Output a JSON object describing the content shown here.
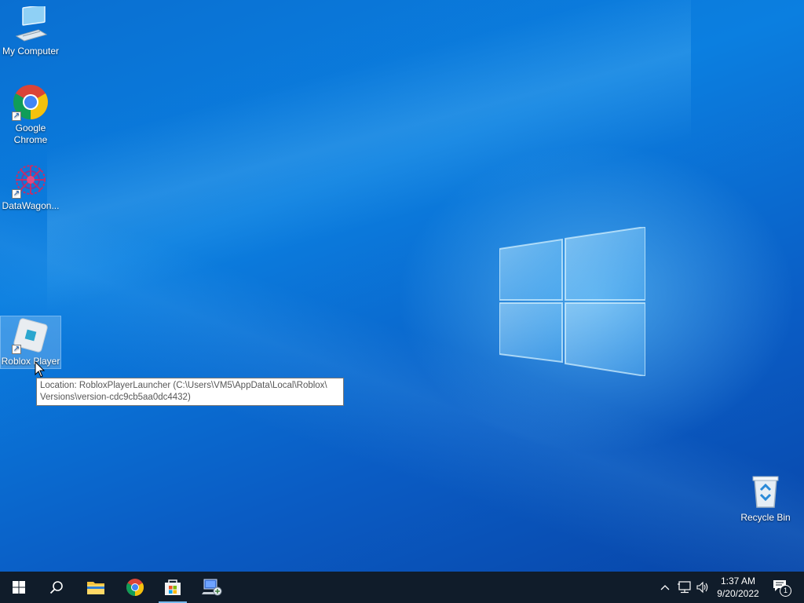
{
  "desktop": {
    "icons": [
      {
        "label": "My Computer",
        "icon": "computer-icon",
        "shortcut": false
      },
      {
        "label": "Google Chrome",
        "icon": "chrome-icon",
        "shortcut": true
      },
      {
        "label": "DataWagon...",
        "icon": "datawagon-icon",
        "shortcut": true
      },
      {
        "label": "Roblox Player",
        "icon": "roblox-icon",
        "shortcut": true,
        "selected": true
      },
      {
        "label": "Recycle Bin",
        "icon": "recycle-bin-icon",
        "shortcut": false
      }
    ],
    "tooltip": {
      "line1": "Location: RobloxPlayerLauncher (C:\\Users\\VM5\\AppData\\Local\\Roblox\\",
      "line2": "Versions\\version-cdc9cb5aa0dc4432)"
    }
  },
  "taskbar": {
    "items": [
      {
        "name": "start-button",
        "icon": "windows-icon"
      },
      {
        "name": "search-button",
        "icon": "search-icon"
      },
      {
        "name": "file-explorer",
        "icon": "folder-icon"
      },
      {
        "name": "google-chrome",
        "icon": "chrome-icon"
      },
      {
        "name": "microsoft-store",
        "icon": "store-icon",
        "active": true
      },
      {
        "name": "network-app",
        "icon": "network-computer-icon"
      }
    ],
    "tray": {
      "icons": [
        "chevron-up-icon",
        "network-icon",
        "volume-icon"
      ],
      "time": "1:37 AM",
      "date": "9/20/2022",
      "notification_count": "1"
    }
  },
  "colors": {
    "desktop_bg": "#0b7fe0",
    "taskbar_bg": "#101c2a",
    "active_indicator": "#76b9ed"
  }
}
